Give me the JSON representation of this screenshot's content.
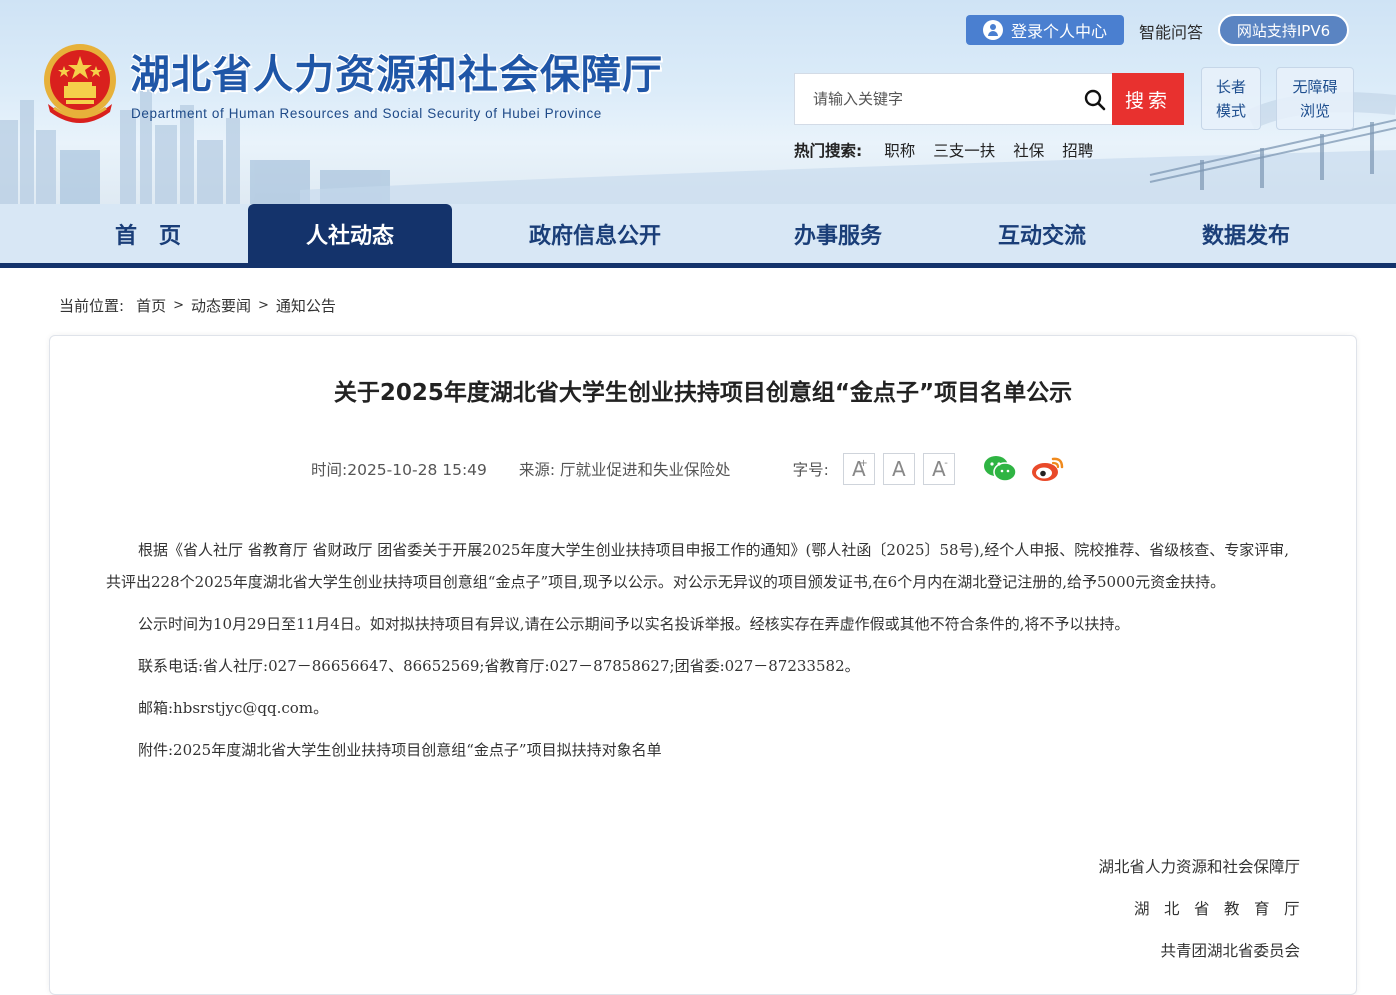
{
  "header": {
    "site_title": "湖北省人力资源和社会保障厅",
    "site_subtitle": "Department of Human Resources and Social Security of Hubei Province",
    "login_label": "登录个人中心",
    "smart_qa_label": "智能问答",
    "ipv6_label": "网站支持IPV6",
    "search_placeholder": "请输入关键字",
    "search_button": "搜索",
    "elder_mode": [
      "长者",
      "模式"
    ],
    "barrier_free": [
      "无障碍",
      "浏览"
    ],
    "hot_search_label": "热门搜索:",
    "hot_search_items": [
      "职称",
      "三支一扶",
      "社保",
      "招聘"
    ]
  },
  "nav": {
    "items": [
      "首　页",
      "人社动态",
      "政府信息公开",
      "办事服务",
      "互动交流",
      "数据发布"
    ],
    "active": "人社动态"
  },
  "breadcrumb": {
    "label": "当前位置:",
    "items": [
      "首页",
      "动态要闻",
      "通知公告"
    ],
    "separator": ">"
  },
  "article": {
    "title": "关于2025年度湖北省大学生创业扶持项目创意组“金点子”项目名单公示",
    "time": "时间:2025-10-28 15:49",
    "source": "来源:  厅就业促进和失业保险处",
    "font_size_label": "字号:",
    "font_buttons": [
      "A",
      "A",
      "A"
    ],
    "paragraphs": [
      "根据《省人社厅 省教育厅 省财政厅 团省委关于开展2025年度大学生创业扶持项目申报工作的通知》(鄂人社函〔2025〕58号),经个人申报、院校推荐、省级核查、专家评审,共评出228个2025年度湖北省大学生创业扶持项目创意组“金点子”项目,现予以公示。对公示无异议的项目颁发证书,在6个月内在湖北登记注册的,给予5000元资金扶持。",
      "公示时间为10月29日至11月4日。如对拟扶持项目有异议,请在公示期间予以实名投诉举报。经核实存在弄虚作假或其他不符合条件的,将不予以扶持。",
      "联系电话:省人社厅:027－86656647、86652569;省教育厅:027－87858627;团省委:027－87233582。",
      "邮箱:hbsrstjyc@qq.com。",
      "附件:2025年度湖北省大学生创业扶持项目创意组“金点子”项目拟扶持对象名单"
    ],
    "signatures": [
      "湖北省人力资源和社会保障厅",
      "湖北省教育厅",
      "共青团湖北省委员会"
    ]
  },
  "colors": {
    "brand_blue": "#14336b",
    "title_blue": "#1f56a7",
    "search_red": "#e8312f",
    "nav_bg": "#d8e7f5",
    "wechat_green": "#2fb443",
    "weibo_orange": "#f08a1d"
  },
  "icons": [
    "emblem-icon",
    "user-icon",
    "search-icon",
    "wechat-icon",
    "weibo-icon"
  ]
}
